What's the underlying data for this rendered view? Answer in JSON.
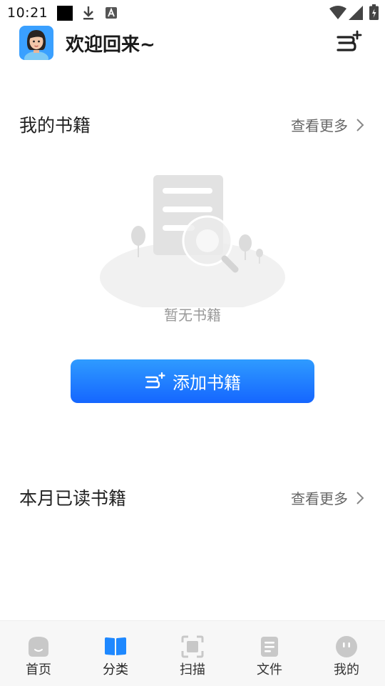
{
  "status_bar": {
    "time": "10:21"
  },
  "header": {
    "welcome": "欢迎回来~"
  },
  "my_books": {
    "title": "我的书籍",
    "more": "查看更多",
    "empty_text": "暂无书籍",
    "add_button": "添加书籍"
  },
  "monthly": {
    "title": "本月已读书籍",
    "more": "查看更多"
  },
  "nav": [
    {
      "label": "首页",
      "icon": "home-face-icon"
    },
    {
      "label": "分类",
      "icon": "book-open-icon"
    },
    {
      "label": "扫描",
      "icon": "scan-icon"
    },
    {
      "label": "文件",
      "icon": "file-icon"
    },
    {
      "label": "我的",
      "icon": "profile-face-icon"
    }
  ],
  "colors": {
    "accent_start": "#2f9bff",
    "accent_end": "#1566ff",
    "nav_icon_inactive": "#c8c8c8",
    "nav_icon_active": "#1e88ff"
  }
}
